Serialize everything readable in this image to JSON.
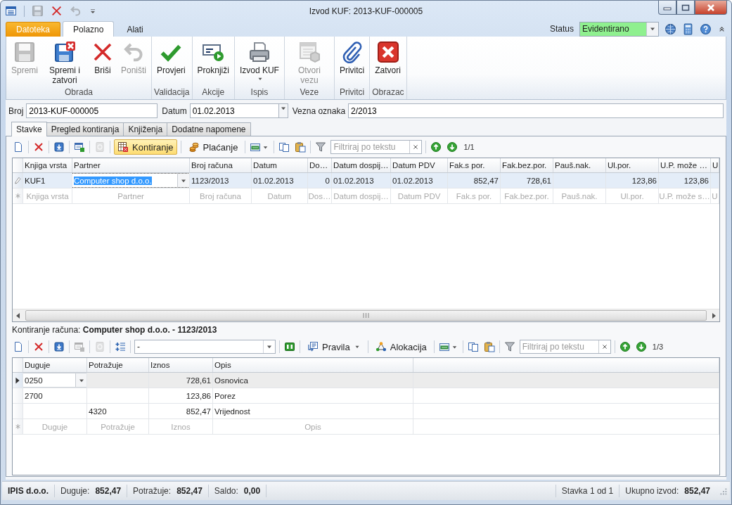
{
  "window": {
    "title": "Izvod KUF: 2013-KUF-000005"
  },
  "quick_access": [
    {
      "kind": "list",
      "disabled": false
    },
    {
      "kind": "floppy",
      "disabled": true
    },
    {
      "kind": "cross",
      "disabled": false
    },
    {
      "kind": "undo",
      "disabled": true
    },
    {
      "kind": "customize",
      "disabled": false
    }
  ],
  "ribbon_tabs": [
    {
      "label": "Datoteka",
      "kind": "file",
      "selected": false
    },
    {
      "label": "Polazno",
      "kind": "tab",
      "selected": true
    },
    {
      "label": "Alati",
      "kind": "tab",
      "selected": false
    }
  ],
  "status": {
    "label": "Status",
    "value": "Evidentirano"
  },
  "ribbon_groups": [
    {
      "label": "Obrada",
      "buttons": [
        {
          "label": "Spremi",
          "kind": "floppy",
          "disabled": true
        },
        {
          "label": "Spremi i zatvori",
          "kind": "floppy-x",
          "disabled": false
        },
        {
          "label": "Briši",
          "kind": "cross",
          "disabled": false
        },
        {
          "label": "Poništi",
          "kind": "undo",
          "disabled": true
        }
      ]
    },
    {
      "label": "Validacija",
      "buttons": [
        {
          "label": "Provjeri",
          "kind": "check",
          "disabled": false
        }
      ]
    },
    {
      "label": "Akcije",
      "buttons": [
        {
          "label": "Proknjiži",
          "kind": "card-play",
          "disabled": false
        }
      ]
    },
    {
      "label": "Ispis",
      "buttons": [
        {
          "label": "Izvod KUF",
          "kind": "printer",
          "disabled": false,
          "dropdown": true
        }
      ]
    },
    {
      "label": "Veze",
      "buttons": [
        {
          "label": "Otvori vezu",
          "kind": "window",
          "disabled": true
        }
      ]
    },
    {
      "label": "Privitci",
      "buttons": [
        {
          "label": "Privitci",
          "kind": "clip",
          "disabled": false
        }
      ]
    },
    {
      "label": "Obrazac",
      "buttons": [
        {
          "label": "Zatvori",
          "kind": "close-red",
          "disabled": false
        }
      ]
    }
  ],
  "fields": [
    {
      "label": "Broj",
      "value": "2013-KUF-000005",
      "kind": "text"
    },
    {
      "label": "Datum",
      "value": "01.02.2013",
      "kind": "date"
    },
    {
      "label": "Vezna oznaka",
      "value": "2/2013",
      "kind": "text"
    }
  ],
  "doc_tabs": [
    {
      "label": "Stavke",
      "selected": true
    },
    {
      "label": "Pregled kontiranja",
      "selected": false
    },
    {
      "label": "Knjiženja",
      "selected": false
    },
    {
      "label": "Dodatne napomene",
      "selected": false
    }
  ],
  "toolbar_top": {
    "groups": [
      [
        {
          "kind": "new",
          "disabled": false
        }
      ],
      [
        {
          "kind": "delete",
          "disabled": false
        }
      ],
      [
        {
          "kind": "save-down",
          "disabled": false
        }
      ],
      [
        {
          "kind": "table",
          "disabled": false
        }
      ],
      [
        {
          "kind": "money",
          "disabled": true
        }
      ],
      [
        {
          "kind": "ledger",
          "label": "Kontiranje",
          "active": true,
          "disabled": false
        }
      ],
      [
        {
          "kind": "coins",
          "label": "Plaćanje",
          "active": false,
          "disabled": false
        }
      ],
      [
        {
          "kind": "excel",
          "dropdown": true,
          "disabled": false
        }
      ],
      [
        {
          "kind": "copy",
          "disabled": false
        },
        {
          "kind": "paste",
          "disabled": false
        }
      ],
      [
        {
          "kind": "funnel",
          "disabled": false
        },
        {
          "kind": "filter",
          "placeholder": "Filtriraj po tekstu"
        }
      ],
      [
        {
          "kind": "up",
          "disabled": false
        },
        {
          "kind": "down",
          "disabled": false
        },
        {
          "kind": "position",
          "text": "1/1"
        }
      ]
    ]
  },
  "grid_top": {
    "columns": [
      "Knjiga vrsta",
      "Partner",
      "Broj računa",
      "Datum",
      "Do…",
      "Datum dospij…",
      "Datum PDV",
      "Fak.s por.",
      "Fak.bez.por.",
      "Pauš.nak.",
      "Ul.por.",
      "U.P. može …",
      "U"
    ],
    "rows": [
      {
        "kind": "data",
        "editing": true,
        "current": false,
        "selected": true,
        "cells": [
          "KUF1",
          {
            "kind": "combo",
            "text": "Computer shop d.o.o.",
            "highlighted": true
          },
          "1123/2013",
          "01.02.2013",
          "0",
          "01.02.2013",
          "01.02.2013",
          "852,47",
          "728,61",
          null,
          "123,86",
          "123,86",
          null
        ]
      },
      {
        "kind": "new",
        "editing": false,
        "current": false,
        "selected": false,
        "cells": [
          "Knjiga vrsta",
          "Partner",
          "Broj računa",
          "Datum",
          "Dos…",
          "Datum dospij…",
          "Datum PDV",
          "Fak.s por.",
          "Fak.bez.por.",
          "Pauš.nak.",
          "Ul.por.",
          "U.P. može s…",
          "U"
        ]
      }
    ]
  },
  "caption": "Kontiranje računa: **Computer shop d.o.o. - 1123/2013**",
  "toolbar_bottom": {
    "groups": [
      [
        {
          "kind": "new",
          "disabled": false
        }
      ],
      [
        {
          "kind": "delete",
          "disabled": false
        }
      ],
      [
        {
          "kind": "save-down",
          "disabled": false
        }
      ],
      [
        {
          "kind": "table",
          "disabled": true
        }
      ],
      [
        {
          "kind": "money",
          "disabled": true
        }
      ],
      [
        {
          "kind": "list-add",
          "disabled": false
        }
      ],
      [
        {
          "kind": "combo",
          "value": "-"
        }
      ],
      [
        {
          "kind": "columns",
          "disabled": false
        }
      ],
      [
        {
          "kind": "rules",
          "label": "Pravila",
          "dropdown": true,
          "active": false,
          "disabled": false
        }
      ],
      [
        {
          "kind": "nodes",
          "label": "Alokacija",
          "active": false,
          "disabled": false
        }
      ],
      [
        {
          "kind": "excel",
          "dropdown": true,
          "disabled": false
        }
      ],
      [
        {
          "kind": "copy",
          "disabled": false
        },
        {
          "kind": "paste",
          "disabled": false
        }
      ],
      [
        {
          "kind": "funnel",
          "disabled": false
        },
        {
          "kind": "filter",
          "placeholder": "Filtriraj po tekstu"
        }
      ],
      [
        {
          "kind": "up",
          "disabled": false
        },
        {
          "kind": "down",
          "disabled": false
        },
        {
          "kind": "position",
          "text": "1/3"
        }
      ]
    ]
  },
  "grid_bottom": {
    "columns": [
      "Duguje",
      "Potražuje",
      "Iznos",
      "Opis"
    ],
    "rows": [
      {
        "kind": "data",
        "editing": false,
        "current": true,
        "selected": true,
        "cells": [
          {
            "kind": "combo",
            "text": "0250",
            "highlighted": false
          },
          null,
          "728,61",
          "Osnovica"
        ]
      },
      {
        "kind": "data",
        "editing": false,
        "current": false,
        "selected": false,
        "cells": [
          "2700",
          null,
          "123,86",
          "Porez"
        ]
      },
      {
        "kind": "data",
        "editing": false,
        "current": false,
        "selected": false,
        "cells": [
          null,
          "4320",
          "852,47",
          "Vrijednost"
        ]
      },
      {
        "kind": "new",
        "editing": false,
        "current": false,
        "selected": false,
        "cells": [
          "Duguje",
          "Potražuje",
          "Iznos",
          "Opis"
        ]
      }
    ]
  },
  "status_bar": {
    "left": [
      {
        "kind": "company",
        "text": "IPIS d.o.o."
      },
      {
        "kind": "total",
        "label": "Duguje:",
        "value": "852,47"
      },
      {
        "kind": "total",
        "label": "Potražuje:",
        "value": "852,47"
      },
      {
        "kind": "total",
        "label": "Saldo:",
        "value": "0,00"
      }
    ],
    "right": [
      {
        "kind": "info",
        "text": "Stavka 1 od 1"
      },
      {
        "kind": "total",
        "label": "Ukupno izvod:",
        "value": "852,47"
      }
    ]
  }
}
